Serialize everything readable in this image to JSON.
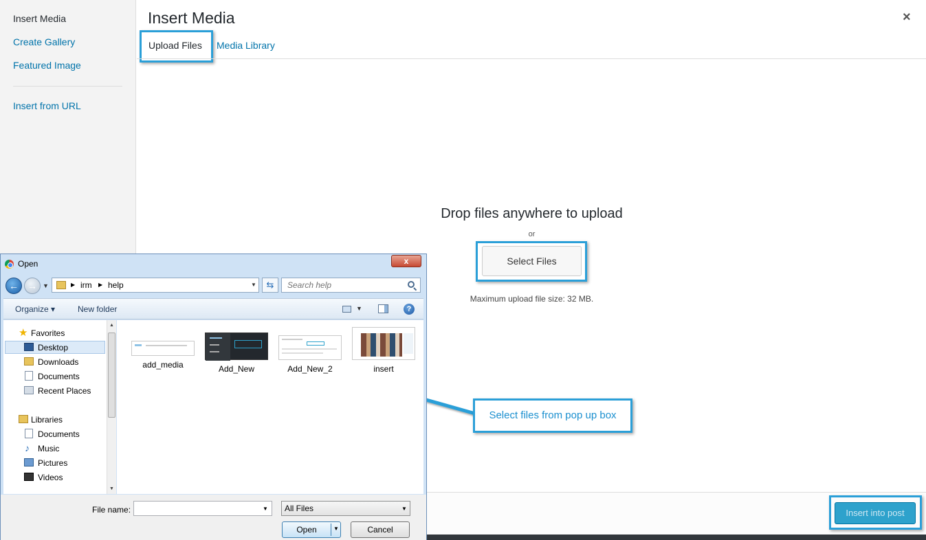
{
  "sidebar": {
    "items": [
      {
        "label": "Insert Media",
        "active": true
      },
      {
        "label": "Create Gallery"
      },
      {
        "label": "Featured Image"
      },
      {
        "label": "Insert from URL"
      }
    ]
  },
  "header": {
    "title": "Insert Media",
    "close_glyph": "×",
    "tabs": [
      {
        "label": "Upload Files",
        "active": true
      },
      {
        "label": "Media Library"
      }
    ]
  },
  "uploader": {
    "drop_text": "Drop files anywhere to upload",
    "or_text": "or",
    "select_button": "Select Files",
    "max_size": "Maximum upload file size: 32 MB."
  },
  "footer": {
    "insert_button": "Insert into post"
  },
  "callout": {
    "text": "Select files from pop up box"
  },
  "dialog": {
    "title": "Open",
    "close_glyph": "x",
    "breadcrumb": [
      "irm",
      "help"
    ],
    "search_placeholder": "Search help",
    "toolbar": {
      "organize": "Organize ▾",
      "new_folder": "New folder",
      "help_glyph": "?"
    },
    "nav": {
      "favorites_label": "Favorites",
      "favorites": [
        "Desktop",
        "Downloads",
        "Documents",
        "Recent Places"
      ],
      "libraries_label": "Libraries",
      "libraries": [
        "Documents",
        "Music",
        "Pictures",
        "Videos"
      ],
      "selected": "Desktop"
    },
    "files": [
      "add_media",
      "Add_New",
      "Add_New_2",
      "insert"
    ],
    "file_name_label": "File name:",
    "file_name_value": "",
    "file_type": "All Files",
    "open_button": "Open",
    "cancel_button": "Cancel"
  },
  "colors": {
    "accent": "#2a9fd8",
    "link": "#0073aa",
    "primary_button": "#2ea2cc"
  }
}
